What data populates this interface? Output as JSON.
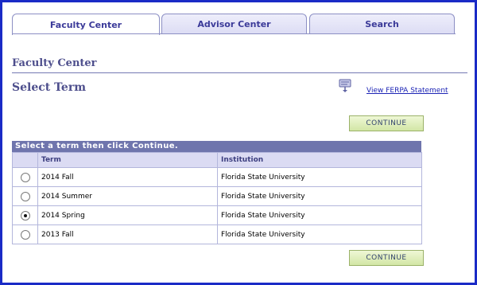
{
  "tabs": [
    {
      "label": "Faculty Center",
      "active": true
    },
    {
      "label": "Advisor Center",
      "active": false
    },
    {
      "label": "Search",
      "active": false
    }
  ],
  "section_title": "Faculty Center",
  "page_title": "Select Term",
  "ferpa": {
    "icon": "ferpa-statement-icon",
    "link_label": "View FERPA Statement"
  },
  "buttons": {
    "continue_top": "CONTINUE",
    "continue_bottom": "CONTINUE"
  },
  "grid": {
    "caption": "Select a term then click Continue.",
    "columns": [
      "",
      "Term",
      "Institution"
    ],
    "rows": [
      {
        "term": "2014 Fall",
        "institution": "Florida State University",
        "selected": false
      },
      {
        "term": "2014 Summer",
        "institution": "Florida State University",
        "selected": false
      },
      {
        "term": "2014 Spring",
        "institution": "Florida State University",
        "selected": true
      },
      {
        "term": "2013 Fall",
        "institution": "Florida State University",
        "selected": false
      }
    ]
  },
  "colors": {
    "frame_border": "#1a2bc6",
    "header_purple": "#6f75ad",
    "button_green": "#d2e6a5",
    "link_blue": "#1c24b5"
  }
}
